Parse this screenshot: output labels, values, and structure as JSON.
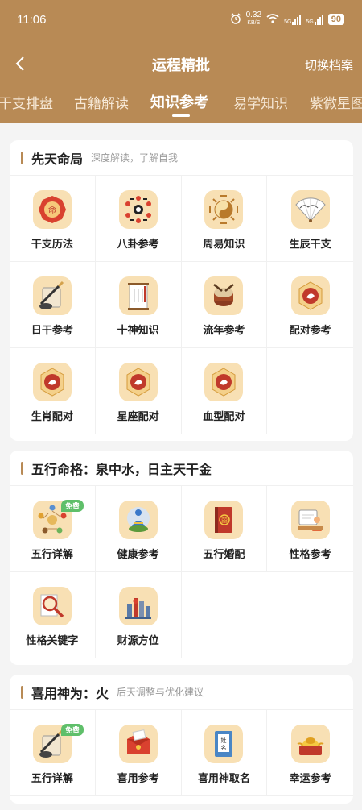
{
  "status_bar": {
    "time": "11:06",
    "net_speed_value": "0.32",
    "net_speed_unit": "KB/S",
    "network_1": "5G",
    "network_2": "5G",
    "battery": "90"
  },
  "nav": {
    "back": "‹",
    "title": "运程精批",
    "switch_label": "切换档案"
  },
  "tabs": [
    {
      "label": "干支排盘",
      "active": false
    },
    {
      "label": "古籍解读",
      "active": false
    },
    {
      "label": "知识参考",
      "active": true
    },
    {
      "label": "易学知识",
      "active": false
    },
    {
      "label": "紫微星图",
      "active": false
    }
  ],
  "sections": [
    {
      "title": "先天命局",
      "subtitle": "深度解读，了解自我",
      "items": [
        {
          "label": "干支历法",
          "icon": "bagua-icon"
        },
        {
          "label": "八卦参考",
          "icon": "bagua-circle-icon"
        },
        {
          "label": "周易知识",
          "icon": "yinyang-icon"
        },
        {
          "label": "生辰干支",
          "icon": "fan-icon"
        },
        {
          "label": "日干参考",
          "icon": "scroll-brush-icon"
        },
        {
          "label": "十神知识",
          "icon": "shishen-scroll-icon"
        },
        {
          "label": "流年参考",
          "icon": "drum-icon"
        },
        {
          "label": "配对参考",
          "icon": "match-seal-icon"
        },
        {
          "label": "生肖配对",
          "icon": "zodiac-seal-icon"
        },
        {
          "label": "星座配对",
          "icon": "star-seal-icon"
        },
        {
          "label": "血型配对",
          "icon": "blood-seal-icon"
        }
      ]
    },
    {
      "title": "五行命格：泉中水，日主天干金",
      "subtitle": "",
      "items": [
        {
          "label": "五行详解",
          "icon": "wuxing-icon",
          "badge": "免费"
        },
        {
          "label": "健康参考",
          "icon": "meditation-icon"
        },
        {
          "label": "五行婚配",
          "icon": "marriage-book-icon"
        },
        {
          "label": "性格参考",
          "icon": "personality-icon"
        },
        {
          "label": "性格关键字",
          "icon": "magnifier-icon"
        },
        {
          "label": "财源方位",
          "icon": "city-icon"
        }
      ]
    },
    {
      "title": "喜用神为：火",
      "subtitle": "后天调整与优化建议",
      "items": [
        {
          "label": "五行详解",
          "icon": "scroll-brush-icon",
          "badge": "免费"
        },
        {
          "label": "喜用参考",
          "icon": "red-envelope-icon"
        },
        {
          "label": "喜用神取名",
          "icon": "name-book-icon",
          "book_text": "姓名"
        },
        {
          "label": "幸运参考",
          "icon": "ingot-icon"
        }
      ]
    }
  ]
}
